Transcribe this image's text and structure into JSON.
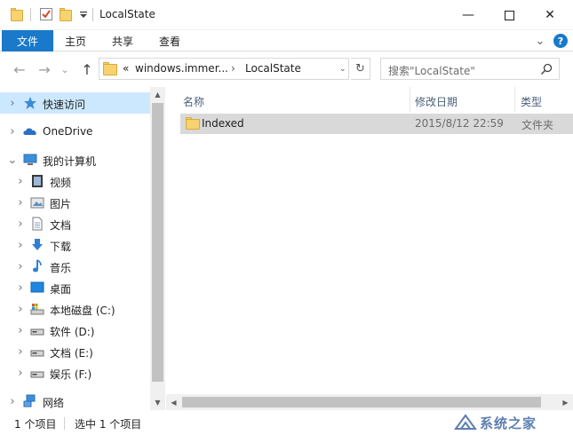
{
  "window": {
    "title": "LocalState",
    "minimize_glyph": "—",
    "maximize_glyph": "☐",
    "close_glyph": "✕"
  },
  "ribbon": {
    "tabs": [
      "文件",
      "主页",
      "共享",
      "查看"
    ],
    "collapse_glyph": "⌄",
    "help_glyph": "?"
  },
  "navigation": {
    "back_glyph": "←",
    "forward_glyph": "→",
    "recent_glyph": "⌄",
    "up_glyph": "↑"
  },
  "address": {
    "prefix": "«",
    "crumbs": [
      "windows.immer...",
      "LocalState"
    ],
    "separator": "›",
    "dropdown_glyph": "⌄",
    "refresh_glyph": "↻"
  },
  "search": {
    "placeholder": "搜索\"LocalState\""
  },
  "nav_pane": {
    "quick_access": "快速访问",
    "onedrive": "OneDrive",
    "this_pc": "我的计算机",
    "items": [
      "视频",
      "图片",
      "文档",
      "下载",
      "音乐",
      "桌面",
      "本地磁盘 (C:)",
      "软件 (D:)",
      "文档 (E:)",
      "娱乐 (F:)"
    ],
    "network": "网络",
    "expand_glyph": "›",
    "expanded_glyph": "⌄"
  },
  "columns": {
    "name": "名称",
    "date": "修改日期",
    "type": "类型",
    "sort_glyph": "^"
  },
  "files": [
    {
      "name": "Indexed",
      "date": "2015/8/12 22:59",
      "type": "文件夹"
    }
  ],
  "status": {
    "count": "1 个项目",
    "selected": "选中 1 个项目"
  },
  "watermark": {
    "text": "系统之家"
  },
  "colors": {
    "accent": "#1979ca",
    "selection": "#cce8ff",
    "folder": "#f6d36f"
  }
}
